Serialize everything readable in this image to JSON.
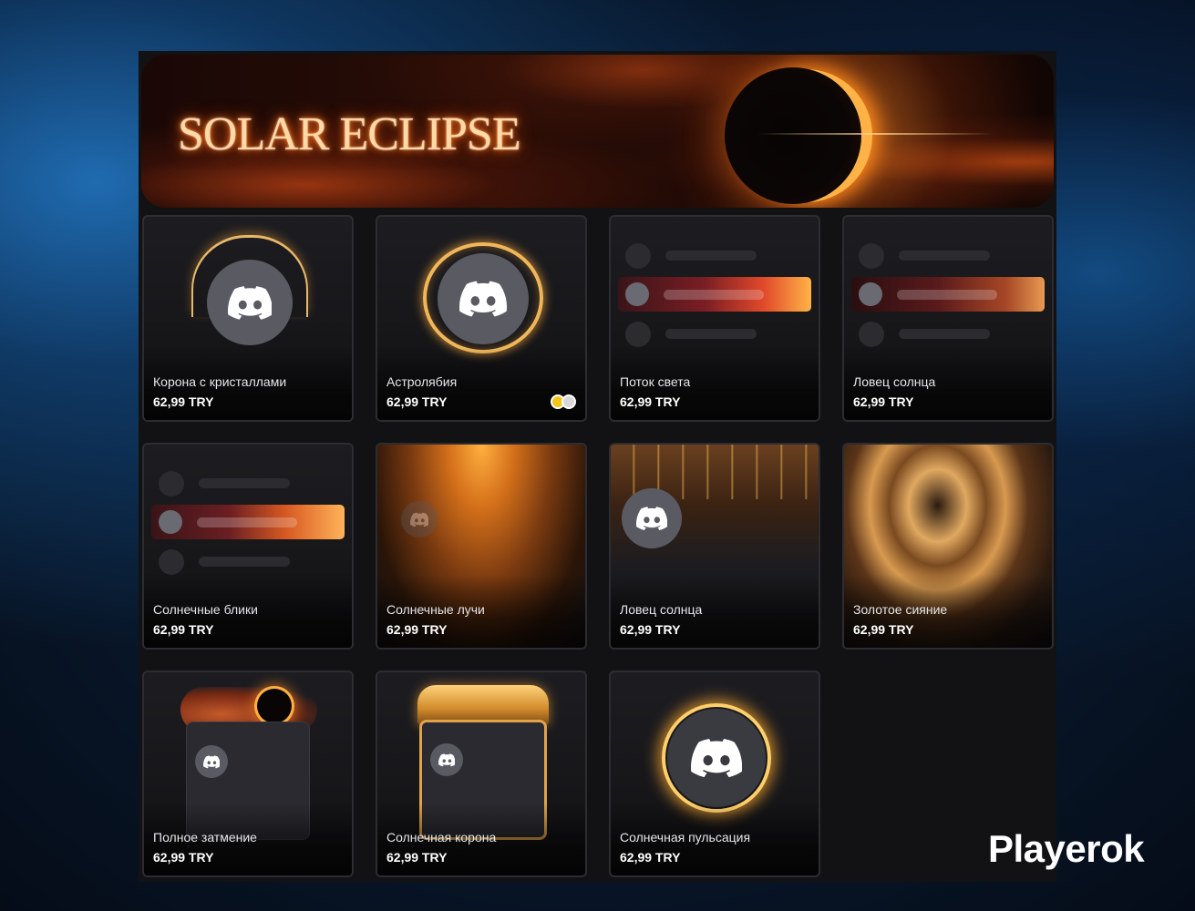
{
  "banner": {
    "title": "SOLAR ECLIPSE"
  },
  "items": [
    {
      "name": "Корона с кристаллами",
      "price": "62,99 TRY"
    },
    {
      "name": "Астролябия",
      "price": "62,99 TRY"
    },
    {
      "name": "Поток света",
      "price": "62,99 TRY"
    },
    {
      "name": "Ловец солнца",
      "price": "62,99 TRY"
    },
    {
      "name": "Солнечные блики",
      "price": "62,99 TRY"
    },
    {
      "name": "Солнечные лучи",
      "price": "62,99 TRY"
    },
    {
      "name": "Ловец солнца",
      "price": "62,99 TRY"
    },
    {
      "name": "Золотое сияние",
      "price": "62,99 TRY"
    },
    {
      "name": "Полное затмение",
      "price": "62,99 TRY"
    },
    {
      "name": "Солнечная корона",
      "price": "62,99 TRY"
    },
    {
      "name": "Солнечная пульсация",
      "price": "62,99 TRY"
    }
  ],
  "watermark": "Playerok",
  "colors": {
    "accent_gold": "#f0b75a",
    "variant_gold": "#f3c41a",
    "variant_silver": "#d8d8dc"
  },
  "icons": {
    "avatar": "discord-logo-icon"
  }
}
